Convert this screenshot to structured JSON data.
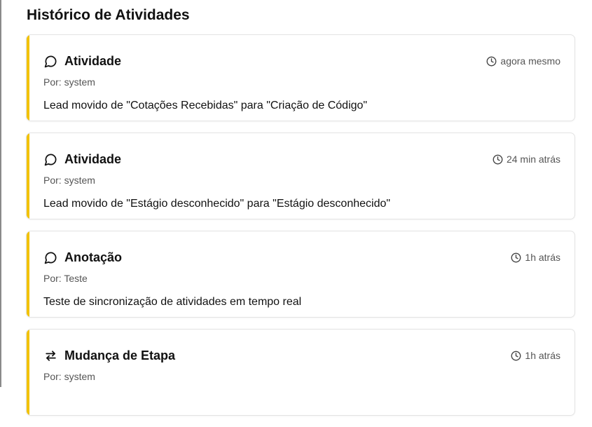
{
  "header": {
    "title": "Histórico de Atividades"
  },
  "colors": {
    "accent": "#f2c200",
    "muted_text": "#555555"
  },
  "activities": [
    {
      "type": "Atividade",
      "icon": "message-circle-icon",
      "time": "agora mesmo",
      "author": "Por: system",
      "message": "Lead movido de \"Cotações Recebidas\" para \"Criação de Código\""
    },
    {
      "type": "Atividade",
      "icon": "message-circle-icon",
      "time": "24 min atrás",
      "author": "Por: system",
      "message": "Lead movido de \"Estágio desconhecido\" para \"Estágio desconhecido\""
    },
    {
      "type": "Anotação",
      "icon": "message-circle-icon",
      "time": "1h atrás",
      "author": "Por: Teste",
      "message": "Teste de sincronização de atividades em tempo real"
    },
    {
      "type": "Mudança de Etapa",
      "icon": "swap-arrows-icon",
      "time": "1h atrás",
      "author": "Por: system",
      "message": ""
    }
  ]
}
